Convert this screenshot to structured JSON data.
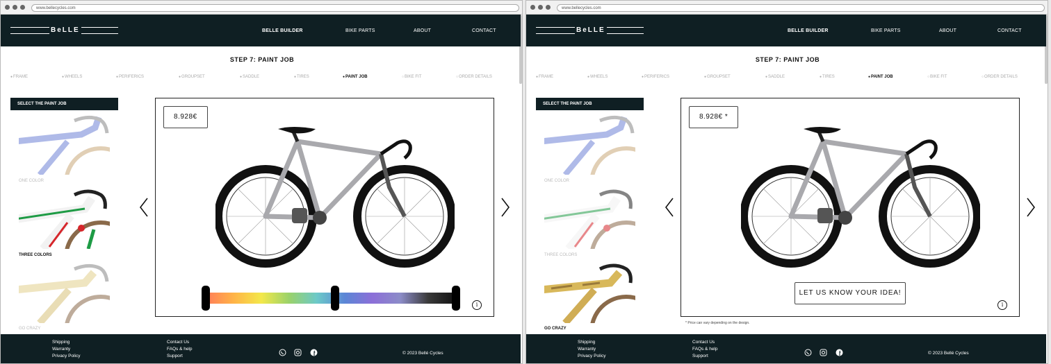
{
  "browser": {
    "url": "www.bellecycles.com"
  },
  "brand": {
    "logo_text": "BeLLE"
  },
  "nav": {
    "items": [
      {
        "label": "BELLE BUILDER"
      },
      {
        "label": "BIKE PARTS"
      },
      {
        "label": "ABOUT"
      },
      {
        "label": "CONTACT"
      }
    ]
  },
  "page": {
    "step_title": "STEP 7: PAINT JOB"
  },
  "steps": [
    {
      "label": "FRAME"
    },
    {
      "label": "WHEELS"
    },
    {
      "label": "PERIFERICS"
    },
    {
      "label": "GROUPSET"
    },
    {
      "label": "SADDLE"
    },
    {
      "label": "TIRES"
    },
    {
      "label": "PAINT JOB"
    },
    {
      "label": "BIKE FIT"
    },
    {
      "label": "ORDER DETAILS"
    }
  ],
  "paint_panel": {
    "heading": "SELECT THE PAINT JOB",
    "options": [
      {
        "label": "ONE COLOR"
      },
      {
        "label": "THREE COLORS"
      },
      {
        "label": "GO CRAZY"
      }
    ]
  },
  "left_view": {
    "price": "8.928€",
    "selected_option": "THREE COLORS",
    "color_slider": {
      "handle_positions_pct": [
        0,
        50,
        100
      ]
    }
  },
  "right_view": {
    "price": "8.928€ *",
    "selected_option": "GO CRAZY",
    "idea_button": "LET US KNOW YOUR IDEA!",
    "price_note": "* Price can vary depending on the design."
  },
  "footer": {
    "col1": [
      "Shipping",
      "Warranty",
      "Privacy Policy"
    ],
    "col2": [
      "Contact Us",
      "FAQs & help",
      "Support"
    ],
    "social": [
      "whatsapp-icon",
      "instagram-icon",
      "facebook-icon"
    ],
    "copyright": "2023 Bellé Cycles"
  },
  "colors": {
    "dark": "#0f1f23",
    "white": "#ffffff"
  }
}
